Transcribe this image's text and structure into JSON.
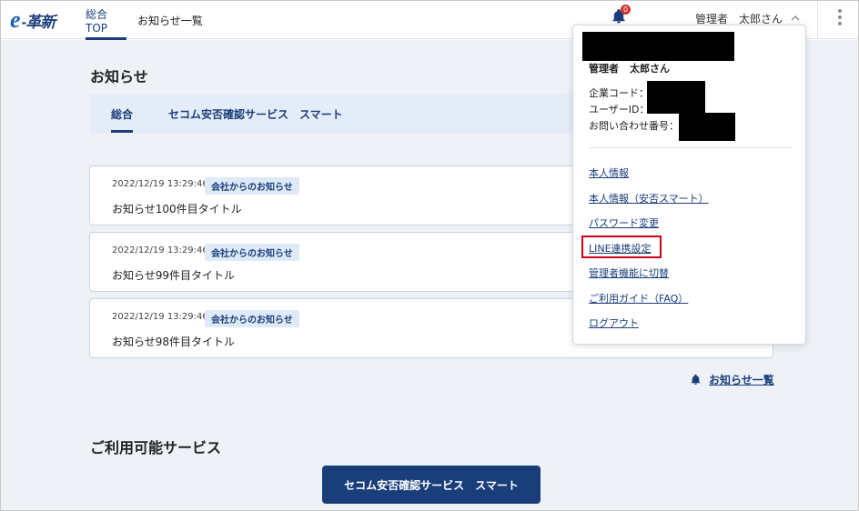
{
  "header": {
    "logo_e": "e",
    "logo_text": "-革新",
    "tabs": [
      {
        "label": "総合TOP",
        "active": true
      },
      {
        "label": "お知らせ一覧",
        "active": false
      }
    ],
    "notification_count": "0",
    "user_role": "管理者",
    "user_name": "太郎さん",
    "icons": {
      "bell": "bell-icon",
      "chevron": "chevron-up-icon",
      "menu": "kebab-menu-icon"
    }
  },
  "main": {
    "title": "お知らせ",
    "subtabs": [
      {
        "label": "総合",
        "active": true
      },
      {
        "label": "セコム安否確認サービス　スマート",
        "active": false
      }
    ],
    "notices": [
      {
        "timestamp": "2022/12/19 13:29:46",
        "tag": "会社からのお知らせ",
        "title": "お知らせ100件目タイトル"
      },
      {
        "timestamp": "2022/12/19 13:29:46",
        "tag": "会社からのお知らせ",
        "title": "お知らせ99件目タイトル"
      },
      {
        "timestamp": "2022/12/19 13:29:46",
        "tag": "会社からのお知らせ",
        "title": "お知らせ98件目タイトル"
      }
    ],
    "more_link": "お知らせ一覧",
    "services_title": "ご利用可能サービス",
    "service_button": "セコム安否確認サービス　スマート"
  },
  "dropdown": {
    "user_role": "管理者",
    "user_name": "太郎さん",
    "company_code_label": "企業コード：",
    "user_id_label": "ユーザーID：",
    "contact_number_label": "お問い合わせ番号：",
    "links": [
      "本人情報",
      "本人情報（安否スマート）",
      "パスワード変更",
      "LINE連携設定",
      "管理者機能に切替",
      "ご利用ガイド（FAQ）",
      "ログアウト"
    ],
    "highlighted_link": "LINE連携設定"
  },
  "colors": {
    "brand": "#1a3e7a",
    "background": "#eef2f7",
    "tag_bg": "#deeaf8",
    "highlight": "#d0021b",
    "badge": "#d32f2f"
  }
}
